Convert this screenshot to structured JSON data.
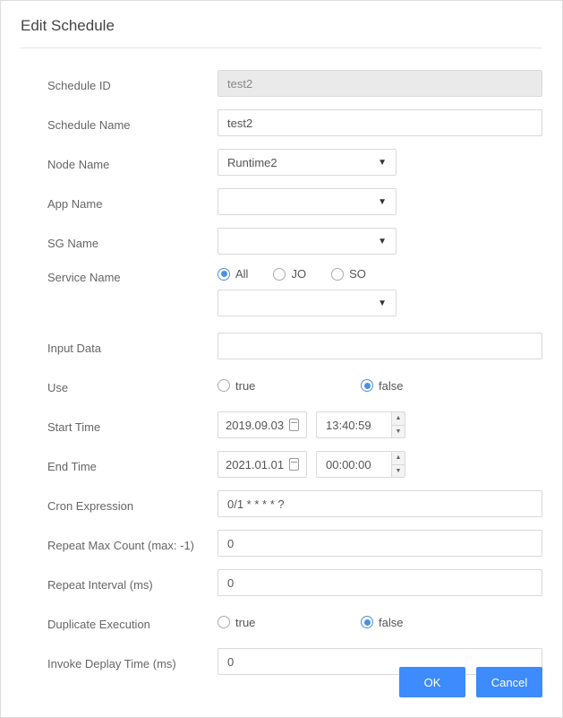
{
  "title": "Edit Schedule",
  "labels": {
    "schedule_id": "Schedule ID",
    "schedule_name": "Schedule Name",
    "node_name": "Node Name",
    "app_name": "App Name",
    "sg_name": "SG Name",
    "service_name": "Service Name",
    "input_data": "Input Data",
    "use": "Use",
    "start_time": "Start Time",
    "end_time": "End Time",
    "cron_expression": "Cron Expression",
    "repeat_max": "Repeat Max Count (max: -1)",
    "repeat_interval": "Repeat Interval (ms)",
    "duplicate_exec": "Duplicate Execution",
    "invoke_delay": "Invoke Deplay Time (ms)"
  },
  "values": {
    "schedule_id": "test2",
    "schedule_name": "test2",
    "node_name": "Runtime2",
    "app_name": "",
    "sg_name": "",
    "service_select": "",
    "input_data": "",
    "start_date": "2019.09.03",
    "start_time": "13:40:59",
    "end_date": "2021.01.01",
    "end_time": "00:00:00",
    "cron": "0/1 * * * * ?",
    "repeat_max": "0",
    "repeat_interval": "0",
    "invoke_delay": "0"
  },
  "radios": {
    "service_name": {
      "options": {
        "all": "All",
        "jo": "JO",
        "so": "SO"
      },
      "selected": "all"
    },
    "use": {
      "options": {
        "true": "true",
        "false": "false"
      },
      "selected": "false"
    },
    "duplicate_exec": {
      "options": {
        "true": "true",
        "false": "false"
      },
      "selected": "false"
    }
  },
  "buttons": {
    "ok": "OK",
    "cancel": "Cancel"
  }
}
